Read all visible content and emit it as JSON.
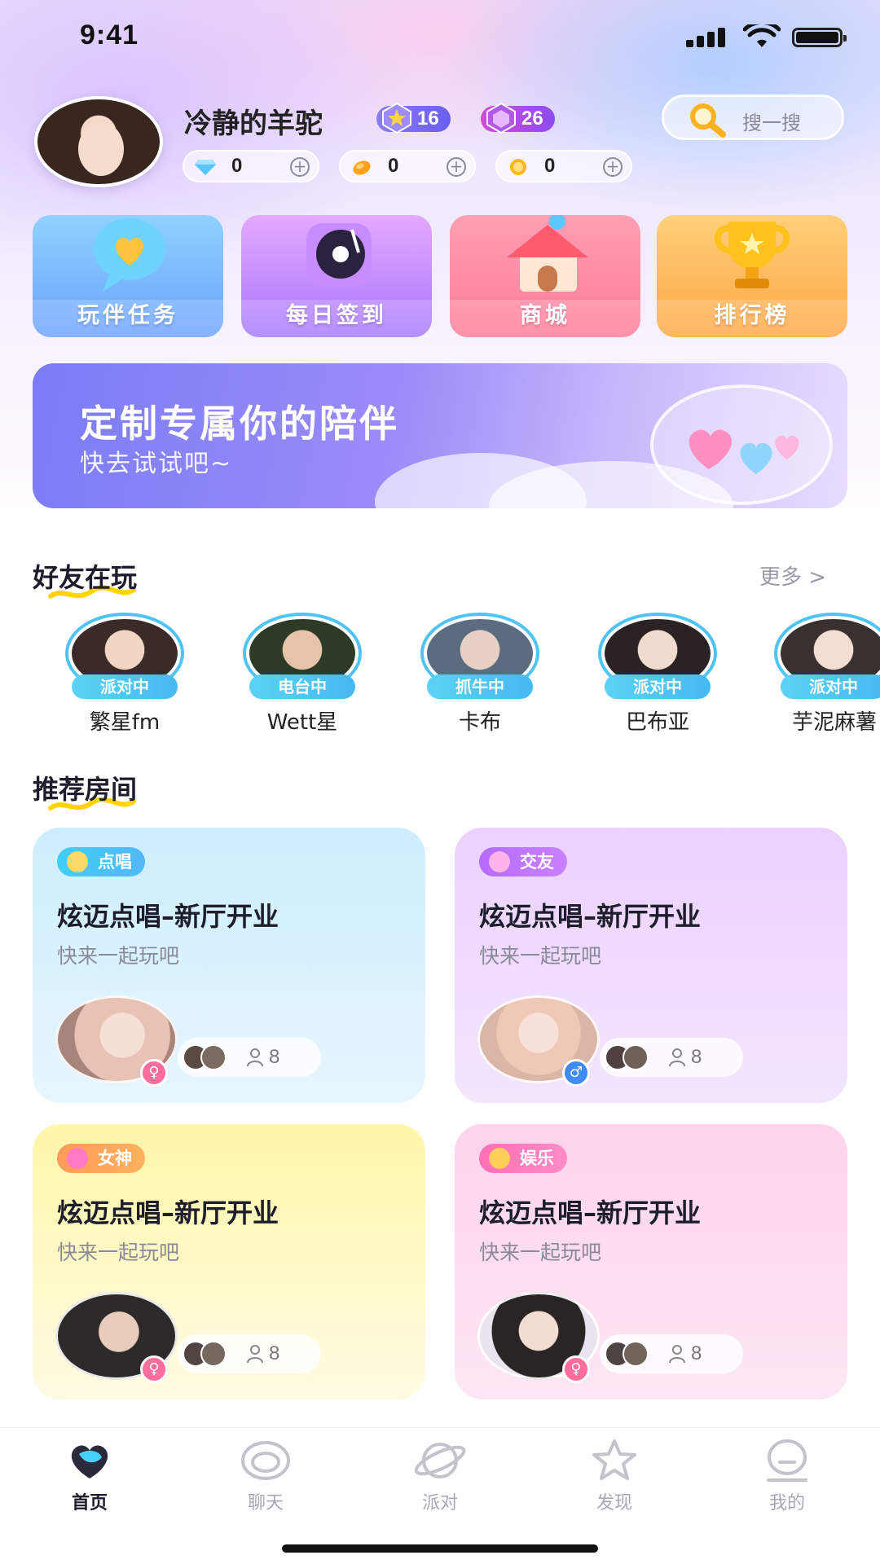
{
  "status_bar": {
    "time": "9:41"
  },
  "profile": {
    "username": "冷静的羊驼",
    "level_badges": [
      {
        "value": "16"
      },
      {
        "value": "26"
      }
    ],
    "search_label": "搜一搜",
    "wallet": [
      {
        "icon": "diamond-icon",
        "value": "0"
      },
      {
        "icon": "bean-icon",
        "value": "0"
      },
      {
        "icon": "coin-icon",
        "value": "0"
      }
    ]
  },
  "quick_tiles": [
    {
      "label": "玩伴任务",
      "icon": "heart-bubble-icon"
    },
    {
      "label": "每日签到",
      "icon": "vinyl-record-icon"
    },
    {
      "label": "商城",
      "icon": "house-icon"
    },
    {
      "label": "排行榜",
      "icon": "trophy-icon"
    }
  ],
  "banner": {
    "title": "定制专属你的陪伴",
    "subtitle": "快去试试吧~"
  },
  "friends_section": {
    "title": "好友在玩",
    "more": "更多 >",
    "friends": [
      {
        "name": "繁星fm",
        "status": "派对中"
      },
      {
        "name": "Wett星",
        "status": "电台中"
      },
      {
        "name": "卡布",
        "status": "抓牛中"
      },
      {
        "name": "巴布亚",
        "status": "派对中"
      },
      {
        "name": "芋泥麻薯",
        "status": "派对中"
      }
    ]
  },
  "rooms_section": {
    "title": "推荐房间",
    "rooms": [
      {
        "tag": "点唱",
        "title": "炫迈点唱–新厅开业",
        "subtitle": "快来一起玩吧",
        "count": "8",
        "gender": "female"
      },
      {
        "tag": "交友",
        "title": "炫迈点唱–新厅开业",
        "subtitle": "快来一起玩吧",
        "count": "8",
        "gender": "male"
      },
      {
        "tag": "女神",
        "title": "炫迈点唱–新厅开业",
        "subtitle": "快来一起玩吧",
        "count": "8",
        "gender": "female"
      },
      {
        "tag": "娱乐",
        "title": "炫迈点唱–新厅开业",
        "subtitle": "快来一起玩吧",
        "count": "8",
        "gender": "female"
      }
    ]
  },
  "tab_bar": {
    "tabs": [
      {
        "label": "首页",
        "active": true
      },
      {
        "label": "聊天",
        "active": false
      },
      {
        "label": "派对",
        "active": false
      },
      {
        "label": "发现",
        "active": false
      },
      {
        "label": "我的",
        "active": false
      }
    ]
  },
  "colors": {
    "accent_cyan": "#4fc4f2",
    "female": "#ff6e9a",
    "male": "#3f8cf5"
  }
}
